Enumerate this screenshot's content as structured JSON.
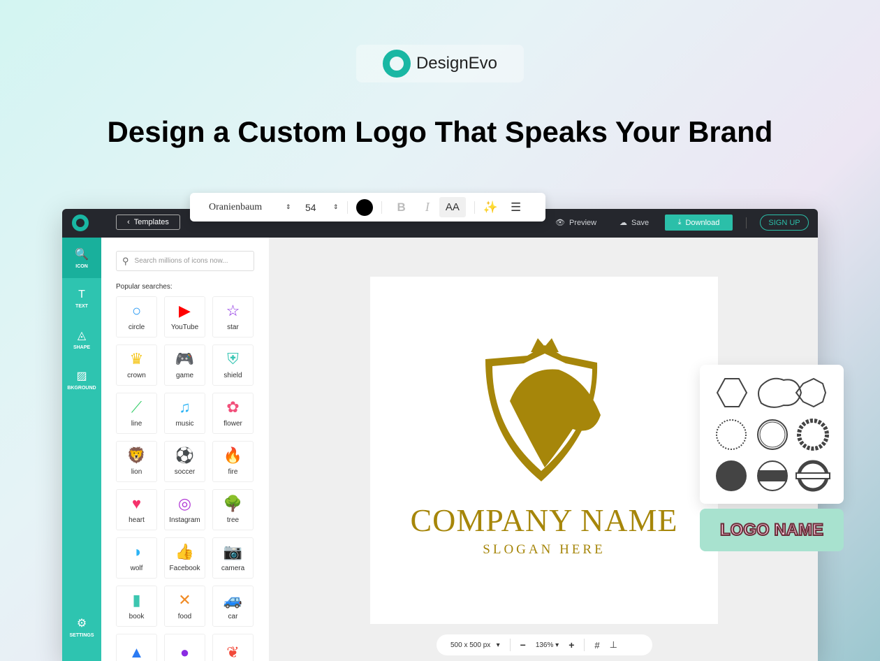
{
  "brand": {
    "name": "DesignEvo"
  },
  "headline": "Design a Custom Logo That Speaks Your Brand",
  "format_toolbar": {
    "font": "Oranienbaum",
    "size": "54",
    "color": "#000000",
    "bold": "B",
    "italic": "I",
    "case": "AA"
  },
  "topbar": {
    "templates": "Templates",
    "preview": "Preview",
    "save": "Save",
    "download": "Download",
    "signup": "SIGN UP"
  },
  "sidebar": {
    "items": [
      {
        "label": "ICON",
        "icon": "🔍"
      },
      {
        "label": "TEXT",
        "icon": "T"
      },
      {
        "label": "SHAPE",
        "icon": "◬"
      },
      {
        "label": "BKGROUND",
        "icon": "▨"
      }
    ],
    "settings": "SETTINGS"
  },
  "panel": {
    "search_placeholder": "Search millions of icons now...",
    "popular": "Popular searches:",
    "icons": [
      {
        "label": "circle",
        "glyph": "○",
        "color": "#2b9af3"
      },
      {
        "label": "YouTube",
        "glyph": "▶",
        "color": "#ff0000"
      },
      {
        "label": "star",
        "glyph": "☆",
        "color": "#8a2be2"
      },
      {
        "label": "crown",
        "glyph": "♛",
        "color": "#f5c518"
      },
      {
        "label": "game",
        "glyph": "🎮",
        "color": "#5b4de0"
      },
      {
        "label": "shield",
        "glyph": "⛨",
        "color": "#39c6b5"
      },
      {
        "label": "line",
        "glyph": "⟋",
        "color": "#3ccf6e"
      },
      {
        "label": "music",
        "glyph": "♫",
        "color": "#2bb3f5"
      },
      {
        "label": "flower",
        "glyph": "✿",
        "color": "#f2507b"
      },
      {
        "label": "lion",
        "glyph": "🦁",
        "color": "#f08a24"
      },
      {
        "label": "soccer",
        "glyph": "⚽",
        "color": "#2b9af3"
      },
      {
        "label": "fire",
        "glyph": "🔥",
        "color": "#f24a3a"
      },
      {
        "label": "heart",
        "glyph": "♥",
        "color": "#f5326b"
      },
      {
        "label": "Instagram",
        "glyph": "◎",
        "color": "#b23ad6"
      },
      {
        "label": "tree",
        "glyph": "🌳",
        "color": "#4cc05a"
      },
      {
        "label": "wolf",
        "glyph": "◑",
        "color": "#2bb3f5"
      },
      {
        "label": "Facebook",
        "glyph": "👍",
        "color": "#2b7bf3"
      },
      {
        "label": "camera",
        "glyph": "📷",
        "color": "#5b4de0"
      },
      {
        "label": "book",
        "glyph": "▮",
        "color": "#3cc6b0"
      },
      {
        "label": "food",
        "glyph": "✕",
        "color": "#f08a24"
      },
      {
        "label": "car",
        "glyph": "🚙",
        "color": "#2bb3f5"
      },
      {
        "label": "",
        "glyph": "▲",
        "color": "#2b7bf3"
      },
      {
        "label": "",
        "glyph": "●",
        "color": "#8a2be2"
      },
      {
        "label": "",
        "glyph": "❦",
        "color": "#f24a3a"
      }
    ]
  },
  "canvas": {
    "company": "COMPANY NAME",
    "slogan": "SLOGAN HERE",
    "logo_color": "#a6860a"
  },
  "bottombar": {
    "size": "500 x 500 px",
    "zoom": "136%"
  },
  "logo_name_sample": "LOGO NAME",
  "colors": {
    "accent": "#2bbfa9",
    "topbar": "#25272d"
  }
}
